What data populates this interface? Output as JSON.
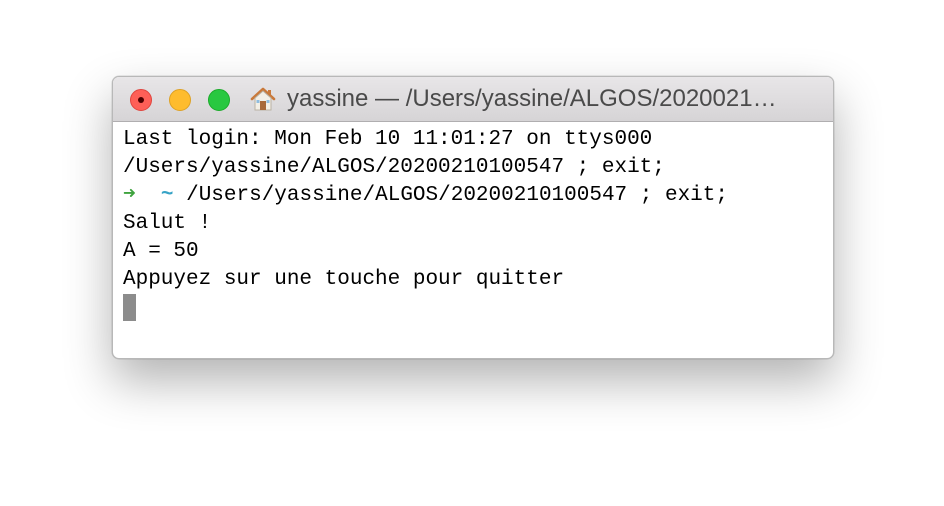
{
  "window": {
    "title": "yassine — /Users/yassine/ALGOS/2020021…"
  },
  "terminal": {
    "lines": [
      "Last login: Mon Feb 10 11:01:27 on ttys000",
      "/Users/yassine/ALGOS/20200210100547 ; exit;"
    ],
    "prompt": {
      "arrow": "➜",
      "tilde": "~",
      "command": " /Users/yassine/ALGOS/20200210100547 ; exit;"
    },
    "output": [
      "Salut !",
      "A = 50",
      "Appuyez sur une touche pour quitter"
    ]
  },
  "colors": {
    "prompt_arrow": "#3fa33f",
    "prompt_tilde": "#37a3c6",
    "close": "#fe5f57",
    "minimize": "#febc2e",
    "maximize": "#28c840"
  }
}
